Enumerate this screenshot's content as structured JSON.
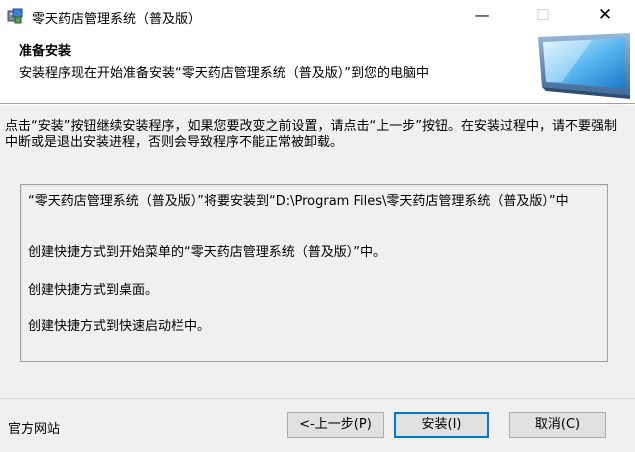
{
  "window": {
    "title": "零天药店管理系统（普及版）",
    "minimize_glyph": "—",
    "maximize_glyph": "☐",
    "close_glyph": "✕"
  },
  "header": {
    "title": "准备安装",
    "description": "安装程序现在开始准备安装“零天药店管理系统（普及版）”到您的电脑中"
  },
  "instruction": "点击“安装”按钮继续安装程序，如果您要改变之前设置，请点击“上一步”按钮。在安装过程中，请不要强制中断或是退出安装进程，否则会导致程序不能正常被卸载。",
  "summary": [
    "“零天药店管理系统（普及版）”将要安装到“D:\\Program Files\\零天药店管理系统（普及版）”中",
    "创建快捷方式到开始菜单的“零天药店管理系统（普及版）”中。",
    "创建快捷方式到桌面。",
    "创建快捷方式到快速启动栏中。"
  ],
  "footer": {
    "site_link": "官方网站",
    "back_label": "<-上一步(P)",
    "install_label": "安装(I)",
    "cancel_label": "取消(C)"
  },
  "colors": {
    "accent": "#0078d7",
    "panel_bg": "#f0f0f0",
    "button_bg": "#e1e1e1"
  },
  "icons": {
    "app": "installer-app-icon",
    "header": "computer-monitor-icon"
  }
}
